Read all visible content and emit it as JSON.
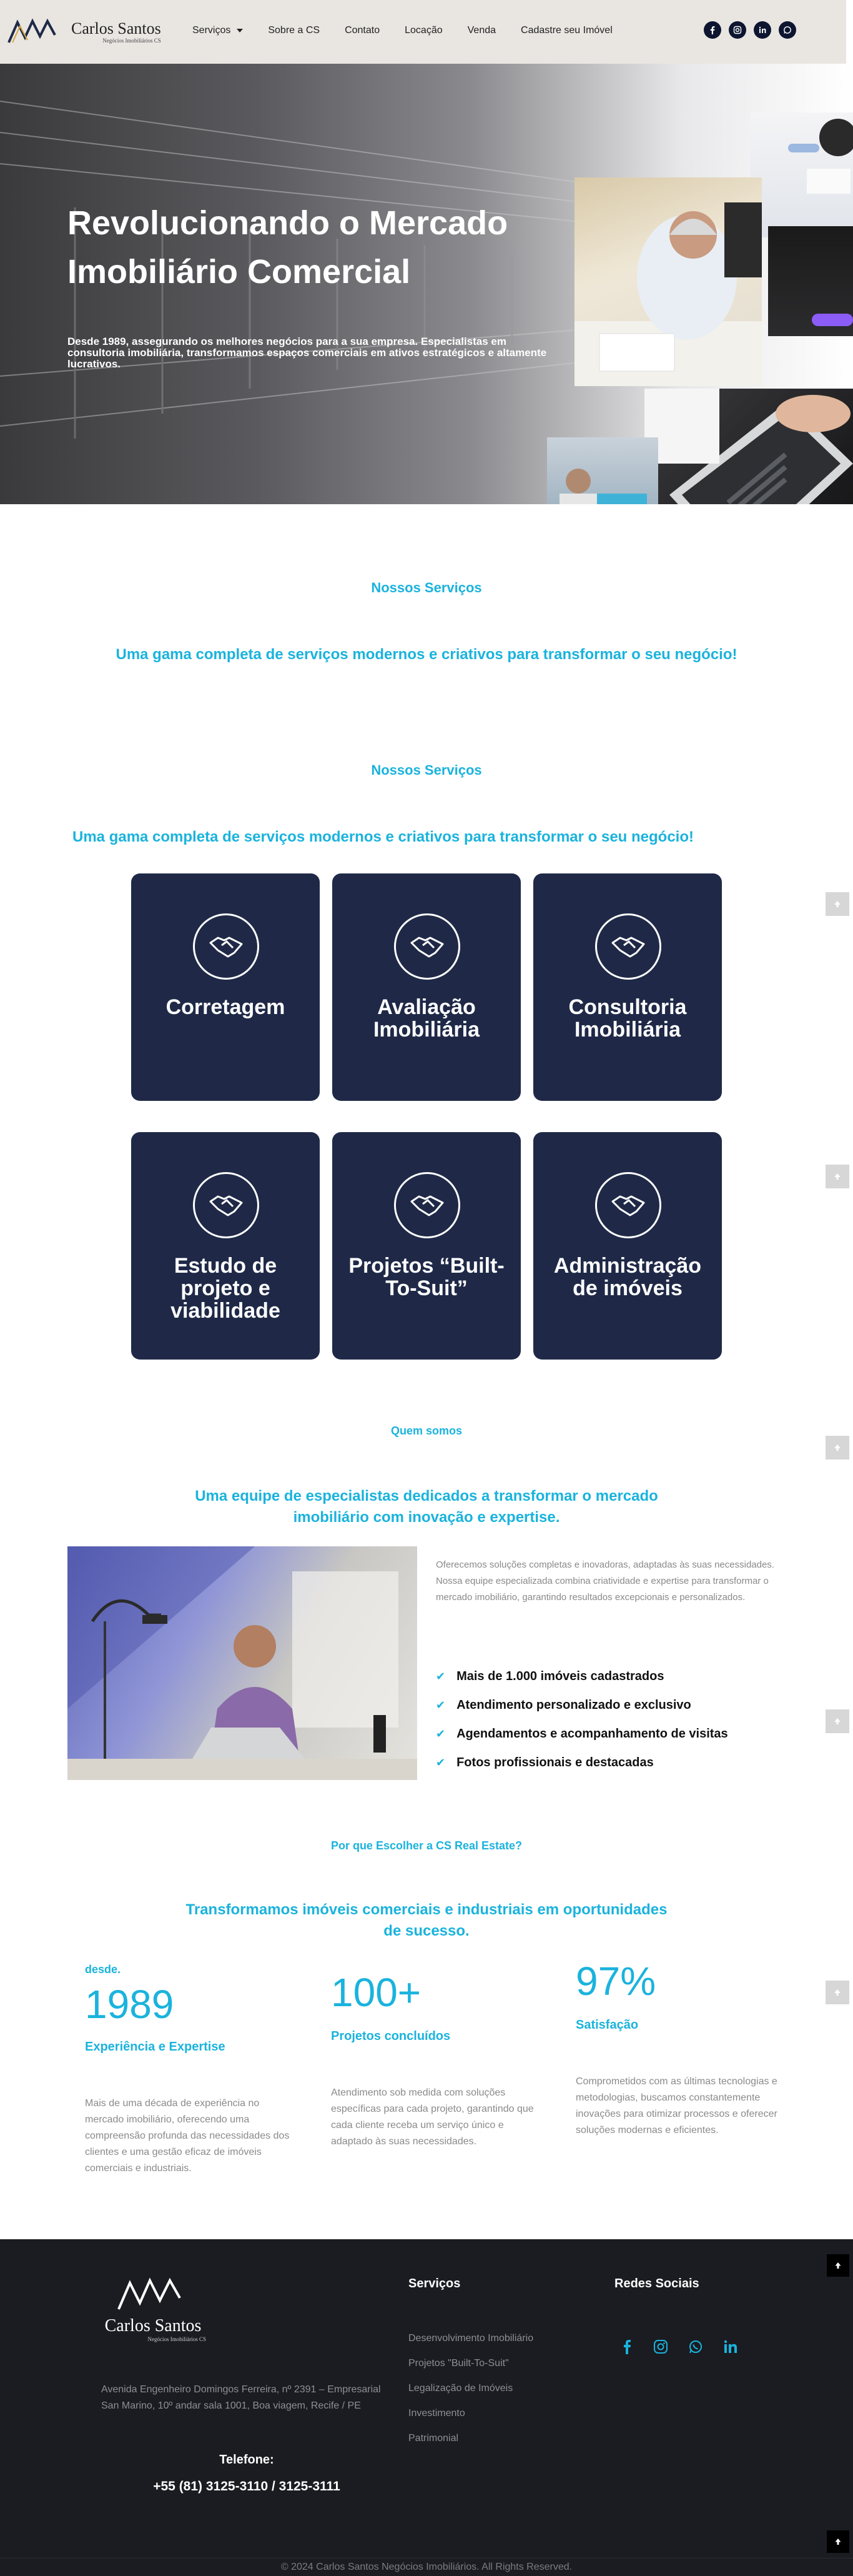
{
  "header": {
    "logo_name": "Carlos Santos",
    "logo_tagline": "Negócios Imobiliários CS",
    "nav": [
      {
        "label": "Serviços"
      },
      {
        "label": "Sobre a CS"
      },
      {
        "label": "Contato"
      },
      {
        "label": "Locação"
      },
      {
        "label": "Venda"
      },
      {
        "label": "Cadastre seu Imóvel"
      }
    ],
    "socials": [
      "facebook-icon",
      "instagram-icon",
      "linkedin-icon",
      "whatsapp-icon"
    ]
  },
  "hero": {
    "title": "Revolucionando o Mercado Imobiliário Comercial",
    "subtitle": "Desde 1989, assegurando os melhores negócios para a sua empresa. Especialistas em consultoria imobiliária, transformamos espaços comerciais em ativos estratégicos e altamente lucrativos."
  },
  "services_intro": {
    "kicker": "Nossos Serviços",
    "lead": "Uma gama completa de serviços modernos e criativos para transformar o seu negócio!"
  },
  "services": {
    "kicker": "Nossos Serviços",
    "lead": "Uma gama completa de serviços modernos e criativos para transformar o seu negócio!",
    "cards": [
      {
        "title": "Corretagem",
        "icon": "handshake-icon"
      },
      {
        "title": "Avaliação Imobiliária",
        "icon": "handshake-icon"
      },
      {
        "title": "Consultoria Imobiliária",
        "icon": "handshake-icon"
      },
      {
        "title": "Estudo de projeto e viabilidade",
        "icon": "handshake-icon"
      },
      {
        "title": "Projetos “Built-To-Suit”",
        "icon": "handshake-icon"
      },
      {
        "title": "Administração de imóveis",
        "icon": "handshake-icon"
      }
    ]
  },
  "about": {
    "kicker": "Quem somos",
    "lead": "Uma equipe de especialistas dedicados a transformar o mercado imobiliário com inovação e expertise.",
    "text": "Oferecemos soluções completas e inovadoras, adaptadas às suas necessidades. Nossa equipe especializada combina criatividade e expertise para transformar o mercado imobiliário, garantindo resultados excepcionais e personalizados.",
    "checks": [
      "Mais de 1.000 imóveis cadastrados",
      "Atendimento personalizado e exclusivo",
      "Agendamentos e acompanhamento de visitas",
      "Fotos profissionais e destacadas"
    ]
  },
  "why": {
    "kicker": "Por que Escolher a CS Real Estate?",
    "lead": "Transformamos imóveis comerciais e industriais em oportunidades de sucesso.",
    "stats": [
      {
        "label": "desde.",
        "number": "1989",
        "caption": "Experiência e Expertise",
        "desc": "Mais de uma década de experiência no mercado imobiliário, oferecendo uma compreensão profunda das necessidades dos clientes e uma gestão eficaz de imóveis comerciais e industriais."
      },
      {
        "label": "",
        "number": "100+",
        "caption": "Projetos concluídos",
        "desc": "Atendimento sob medida com soluções específicas para cada projeto, garantindo que cada cliente receba um serviço único e adaptado às suas necessidades."
      },
      {
        "label": "",
        "number": "97%",
        "caption": "Satisfação",
        "desc": "Comprometidos com as últimas tecnologias e metodologias, buscamos constantemente inovações para otimizar processos e oferecer soluções modernas e eficientes."
      }
    ]
  },
  "footer": {
    "logo_name": "Carlos Santos",
    "logo_tagline": "Negócios Imobiliários CS",
    "address": "Avenida Engenheiro Domingos Ferreira, nº 2391 – Empresarial San Marino, 10º andar sala 1001, Boa viagem, Recife / PE",
    "phone_label": "Telefone:",
    "phone": "+55 (81) 3125-3110 / 3125-3111",
    "services_title": "Serviços",
    "service_links": [
      "Desenvolvimento Imobiliário",
      "Projetos \"Built-To-Suit\"",
      "Legalização de Imóveis",
      "Investimento",
      "Patrimonial"
    ],
    "social_title": "Redes Sociais",
    "copyright": "© 2024 Carlos Santos Negócios Imobiliários. All Rights Reserved."
  },
  "colors": {
    "accent": "#1ab3dd",
    "card": "#1f2947",
    "footer": "#1a1c21",
    "header": "#e9e6e2"
  }
}
